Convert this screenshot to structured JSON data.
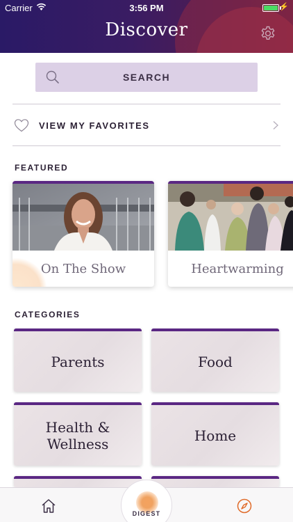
{
  "status_bar": {
    "carrier": "Carrier",
    "time": "3:56 PM"
  },
  "header": {
    "title": "Discover",
    "settings_icon": "gear-icon"
  },
  "search": {
    "label": "SEARCH",
    "icon": "search-icon"
  },
  "favorites": {
    "label": "VIEW MY FAVORITES",
    "icon": "heart-icon"
  },
  "featured": {
    "section_title": "FEATURED",
    "items": [
      {
        "title": "On The Show"
      },
      {
        "title": "Heartwarming"
      }
    ]
  },
  "categories": {
    "section_title": "CATEGORIES",
    "items": [
      {
        "label": "Parents"
      },
      {
        "label": "Food"
      },
      {
        "label": "Health & Wellness"
      },
      {
        "label": "Home"
      }
    ]
  },
  "tab_bar": {
    "digest_label": "DIGEST",
    "home_icon": "home-icon",
    "discover_icon": "compass-icon",
    "active_color": "#e06b2a"
  },
  "colors": {
    "accent_purple": "#5a2783",
    "search_bg": "#dcd0e6",
    "header_start": "#2a1a66",
    "header_end": "#6a2043"
  }
}
